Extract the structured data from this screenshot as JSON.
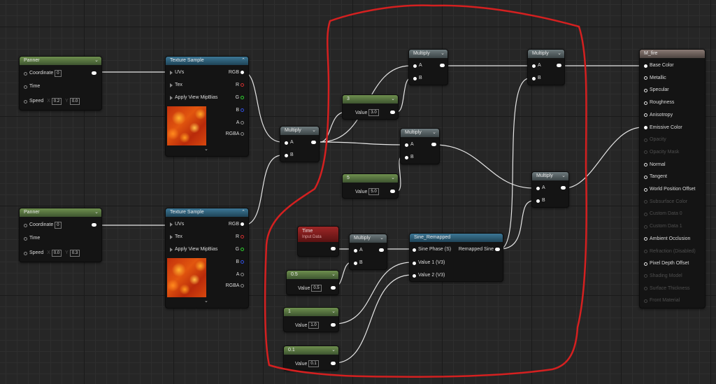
{
  "nodes": {
    "panner1": {
      "title": "Panner",
      "coord_label": "Coordinate",
      "coord_value": "0",
      "time_label": "Time",
      "speed_label": "Speed",
      "x_label": "X",
      "x_value": "0.2",
      "y_label": "Y",
      "y_value": "0.0"
    },
    "panner2": {
      "title": "Panner",
      "coord_label": "Coordinate",
      "coord_value": "0",
      "time_label": "Time",
      "speed_label": "Speed",
      "x_label": "X",
      "x_value": "0.0",
      "y_label": "Y",
      "y_value": "0.3"
    },
    "texture1": {
      "title": "Texture Sample",
      "uvs": "UVs",
      "tex": "Tex",
      "apply": "Apply View MipBias",
      "rgb": "RGB",
      "r": "R",
      "g": "G",
      "b": "B",
      "a": "A",
      "rgba": "RGBA"
    },
    "texture2": {
      "title": "Texture Sample",
      "uvs": "UVs",
      "tex": "Tex",
      "apply": "Apply View MipBias",
      "rgb": "RGB",
      "r": "R",
      "g": "G",
      "b": "B",
      "a": "A",
      "rgba": "RGBA"
    },
    "multiply_tex": {
      "title": "Multiply",
      "a": "A",
      "b": "B"
    },
    "multiply_top1": {
      "title": "Multiply",
      "a": "A",
      "b": "B"
    },
    "multiply_top2": {
      "title": "Multiply",
      "a": "A",
      "b": "B"
    },
    "multiply_mid": {
      "title": "Multiply",
      "a": "A",
      "b": "B"
    },
    "multiply_right": {
      "title": "Multiply",
      "a": "A",
      "b": "B"
    },
    "multiply_time": {
      "title": "Multiply",
      "a": "A",
      "b": "B"
    },
    "const3": {
      "title": "3",
      "value_label": "Value",
      "value": "3.0"
    },
    "const5": {
      "title": "5",
      "value_label": "Value",
      "value": "5.0"
    },
    "const05": {
      "title": "0.5",
      "value_label": "Value",
      "value": "0.5"
    },
    "const1": {
      "title": "1",
      "value_label": "Value",
      "value": "1.0"
    },
    "const01": {
      "title": "0.1",
      "value_label": "Value",
      "value": "0.1"
    },
    "time": {
      "title": "Time",
      "subtitle": "Input Data"
    },
    "sine": {
      "title": "Sine_Remapped",
      "phase": "Sine Phase (S)",
      "out": "Remapped Sine",
      "v1": "Value 1 (V3)",
      "v2": "Value 2 (V3)"
    },
    "material": {
      "title": "M_fire",
      "pins": [
        {
          "label": "Base Color",
          "active": true,
          "connected": true
        },
        {
          "label": "Metallic",
          "active": true,
          "connected": false
        },
        {
          "label": "Specular",
          "active": true,
          "connected": false
        },
        {
          "label": "Roughness",
          "active": true,
          "connected": false
        },
        {
          "label": "Anisotropy",
          "active": true,
          "connected": false
        },
        {
          "label": "Emissive Color",
          "active": true,
          "connected": true
        },
        {
          "label": "Opacity",
          "active": false,
          "connected": false
        },
        {
          "label": "Opacity Mask",
          "active": false,
          "connected": false
        },
        {
          "label": "Normal",
          "active": true,
          "connected": false
        },
        {
          "label": "Tangent",
          "active": true,
          "connected": false
        },
        {
          "label": "World Position Offset",
          "active": true,
          "connected": false
        },
        {
          "label": "Subsurface Color",
          "active": false,
          "connected": false
        },
        {
          "label": "Custom Data 0",
          "active": false,
          "connected": false
        },
        {
          "label": "Custom Data 1",
          "active": false,
          "connected": false
        },
        {
          "label": "Ambient Occlusion",
          "active": true,
          "connected": false
        },
        {
          "label": "Refraction (Disabled)",
          "active": false,
          "connected": false
        },
        {
          "label": "Pixel Depth Offset",
          "active": true,
          "connected": false
        },
        {
          "label": "Shading Model",
          "active": false,
          "connected": false
        },
        {
          "label": "Surface Thickness",
          "active": false,
          "connected": false
        },
        {
          "label": "Front Material",
          "active": false,
          "connected": false
        }
      ]
    }
  },
  "colors": {
    "canvas": "#262626",
    "wire": "#e6e6e6",
    "annotation": "#d42020",
    "header_green": "#5a7a3e",
    "header_blue": "#2e6180",
    "header_red": "#8a1c1c"
  }
}
